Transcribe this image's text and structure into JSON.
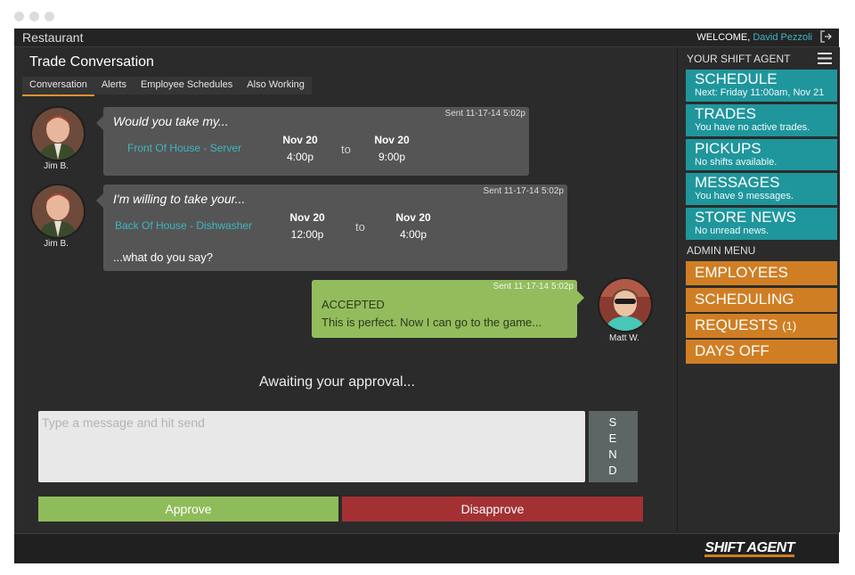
{
  "app": {
    "title": "Restaurant",
    "welcome_label": "WELCOME,",
    "user_name": "David Pezzoli"
  },
  "page": {
    "title": "Trade Conversation"
  },
  "tabs": [
    {
      "label": "Conversation",
      "active": true
    },
    {
      "label": "Alerts",
      "active": false
    },
    {
      "label": "Employee Schedules",
      "active": false
    },
    {
      "label": "Also Working",
      "active": false
    }
  ],
  "messages": [
    {
      "author": "Jim B.",
      "sent": "Sent 11-17-14 5:02p",
      "text": "Would you take my...",
      "shift": "Front Of House - Server",
      "from_date": "Nov 20",
      "from_time": "4:00p",
      "to_label": "to",
      "to_date": "Nov 20",
      "to_time": "9:00p"
    },
    {
      "author": "Jim B.",
      "sent": "Sent 11-17-14 5:02p",
      "text": "I'm willing to take your...",
      "shift": "Back Of House - Dishwasher",
      "from_date": "Nov 20",
      "from_time": "12:00p",
      "to_label": "to",
      "to_date": "Nov 20",
      "to_time": "4:00p",
      "followup": "...what do you say?"
    },
    {
      "author": "Matt W.",
      "sent": "Sent 11-17-14 5:02p",
      "status": "ACCEPTED",
      "text": "This is perfect. Now I can go to the game..."
    }
  ],
  "status_text": "Awaiting your approval...",
  "composer": {
    "placeholder": "Type a message and hit send",
    "send_letters": [
      "S",
      "E",
      "N",
      "D"
    ]
  },
  "actions": {
    "approve": "Approve",
    "disapprove": "Disapprove"
  },
  "sidebar": {
    "heading": "YOUR SHIFT AGENT",
    "items": [
      {
        "title": "SCHEDULE",
        "subtitle": "Next: Friday 11:00am, Nov 21"
      },
      {
        "title": "TRADES",
        "subtitle": "You have no active trades."
      },
      {
        "title": "PICKUPS",
        "subtitle": "No shifts available."
      },
      {
        "title": "MESSAGES",
        "subtitle": "You have 9 messages."
      },
      {
        "title": "STORE NEWS",
        "subtitle": "No unread news."
      }
    ],
    "admin_heading": "ADMIN MENU",
    "admin_items": [
      {
        "label": "EMPLOYEES",
        "count": ""
      },
      {
        "label": "SCHEDULING",
        "count": ""
      },
      {
        "label": "REQUESTS",
        "count": "(1)"
      },
      {
        "label": "DAYS OFF",
        "count": ""
      }
    ]
  },
  "footer": {
    "logo": "SHIFT AGENT"
  },
  "colors": {
    "teal": "#1f969c",
    "orange": "#d07e24",
    "green": "#93bc5d",
    "red": "#a33133",
    "accent_text": "#3fb6c0"
  }
}
